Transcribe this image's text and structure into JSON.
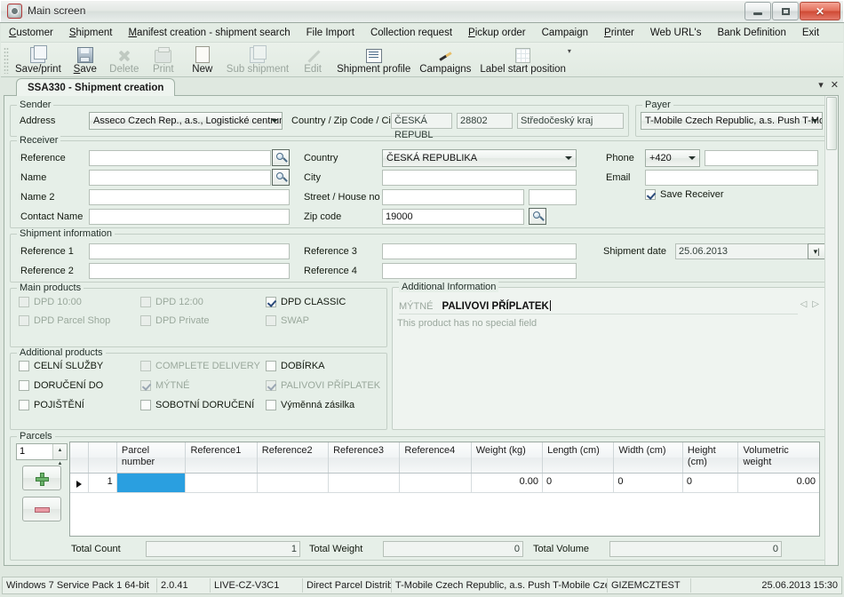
{
  "window": {
    "title": "Main screen",
    "minimize_label": "Minimize",
    "maximize_label": "Maximize",
    "close_label": "✕"
  },
  "menubar": [
    {
      "label": "Customer",
      "accel": "C"
    },
    {
      "label": "Shipment",
      "accel": "S"
    },
    {
      "label": "Manifest creation - shipment search",
      "accel": "M"
    },
    {
      "label": "File Import",
      "accel": ""
    },
    {
      "label": "Collection request",
      "accel": ""
    },
    {
      "label": "Pickup order",
      "accel": "P"
    },
    {
      "label": "Campaign",
      "accel": ""
    },
    {
      "label": "Printer",
      "accel": "P"
    },
    {
      "label": "Web URL's",
      "accel": ""
    },
    {
      "label": "Bank Definition",
      "accel": ""
    },
    {
      "label": "Exit",
      "accel": ""
    }
  ],
  "toolbar": [
    {
      "label": "Save/print",
      "icon": "save-print-icon",
      "enabled": true
    },
    {
      "label": "Save",
      "icon": "floppy-icon",
      "enabled": true
    },
    {
      "label": "Delete",
      "icon": "delete-x-icon",
      "enabled": false
    },
    {
      "label": "Print",
      "icon": "printer-icon",
      "enabled": false
    },
    {
      "label": "New",
      "icon": "new-document-icon",
      "enabled": true
    },
    {
      "label": "Sub shipment",
      "icon": "sub-shipment-icon",
      "enabled": false
    },
    {
      "label": "Edit",
      "icon": "pencil-icon",
      "enabled": false
    },
    {
      "label": "Shipment profile",
      "icon": "shipment-profile-icon",
      "enabled": true
    },
    {
      "label": "Campaigns",
      "icon": "campaign-pen-icon",
      "enabled": true
    },
    {
      "label": "Label start position",
      "icon": "label-grid-icon",
      "enabled": true,
      "dropdown": true
    }
  ],
  "tab": {
    "label": "SSA330 - Shipment creation",
    "minimize_glyph": "▾",
    "close_glyph": "✕"
  },
  "sender": {
    "legend": "Sender",
    "address_label": "Address",
    "address_value": "Asseco Czech Rep., a.s., Logistické centrum",
    "country_zip_city_label": "Country / Zip Code / City",
    "country_value": "ČESKÁ REPUBL",
    "zip_value": "28802",
    "city_value": "Středočeský kraj"
  },
  "payer": {
    "legend": "Payer",
    "value": "T-Mobile Czech Republic, a.s. Push T-Mobile C"
  },
  "receiver": {
    "legend": "Receiver",
    "reference_label": "Reference",
    "reference_value": "",
    "name_label": "Name",
    "name_value": "",
    "name2_label": "Name 2",
    "name2_value": "",
    "contact_name_label": "Contact Name",
    "contact_name_value": "",
    "country_label": "Country",
    "country_value": "ČESKÁ REPUBLIKA",
    "city_label": "City",
    "city_value": "",
    "street_label": "Street / House no",
    "street_value": "",
    "house_no_value": "",
    "zip_label": "Zip code",
    "zip_value": "19000",
    "phone_label": "Phone",
    "phone_prefix": "+420",
    "phone_value": "",
    "email_label": "Email",
    "email_value": "",
    "save_receiver_label": "Save Receiver",
    "save_receiver_checked": true
  },
  "shipment_information": {
    "legend": "Shipment information",
    "reference1_label": "Reference 1",
    "reference1_value": "",
    "reference2_label": "Reference 2",
    "reference2_value": "",
    "reference3_label": "Reference 3",
    "reference3_value": "",
    "reference4_label": "Reference 4",
    "reference4_value": "",
    "shipment_date_label": "Shipment date",
    "shipment_date_value": "25.06.2013"
  },
  "main_products": {
    "legend": "Main products",
    "items": [
      {
        "label": "DPD 10:00",
        "checked": false,
        "enabled": false
      },
      {
        "label": "DPD 12:00",
        "checked": false,
        "enabled": false
      },
      {
        "label": "DPD CLASSIC",
        "checked": true,
        "enabled": true
      },
      {
        "label": "DPD Parcel Shop",
        "checked": false,
        "enabled": false
      },
      {
        "label": "DPD Private",
        "checked": false,
        "enabled": false
      },
      {
        "label": "SWAP",
        "checked": false,
        "enabled": false
      }
    ]
  },
  "additional_products": {
    "legend": "Additional products",
    "items": [
      {
        "label": "CELNÍ SLUŽBY",
        "checked": false,
        "enabled": true
      },
      {
        "label": "COMPLETE DELIVERY",
        "checked": false,
        "enabled": false
      },
      {
        "label": "DOBÍRKA",
        "checked": false,
        "enabled": true
      },
      {
        "label": "DORUČENÍ DO",
        "checked": false,
        "enabled": true
      },
      {
        "label": "MÝTNÉ",
        "checked": true,
        "enabled": false
      },
      {
        "label": "PALIVOVI PŘÍPLATEK",
        "checked": true,
        "enabled": false
      },
      {
        "label": "POJIŠTĚNÍ",
        "checked": false,
        "enabled": true
      },
      {
        "label": "SOBOTNÍ DORUČENÍ",
        "checked": false,
        "enabled": true
      },
      {
        "label": "Výměnná zásilka",
        "checked": false,
        "enabled": true
      }
    ]
  },
  "additional_information": {
    "legend": "Additional Information",
    "tabs": [
      {
        "label": "MÝTNÉ",
        "active": false
      },
      {
        "label": "PALIVOVI PŘÍPLATEK",
        "active": true
      }
    ],
    "nav_prev": "◁",
    "nav_next": "▷",
    "note": "This product has no special field"
  },
  "parcels": {
    "legend": "Parcels",
    "count_value": "1",
    "add_button_label": "add-parcel",
    "remove_button_label": "remove-parcel",
    "columns": [
      "",
      "",
      "Parcel\nnumber",
      "Reference1",
      "Reference2",
      "Reference3",
      "Reference4",
      "Weight (kg)",
      "Length (cm)",
      "Width (cm)",
      "Height\n(cm)",
      "Volumetric\nweight"
    ],
    "column_display": [
      {
        "line1": "",
        "line2": ""
      },
      {
        "line1": "",
        "line2": ""
      },
      {
        "line1": "Parcel",
        "line2": "number"
      },
      {
        "line1": "Reference1",
        "line2": ""
      },
      {
        "line1": "Reference2",
        "line2": ""
      },
      {
        "line1": "Reference3",
        "line2": ""
      },
      {
        "line1": "Reference4",
        "line2": ""
      },
      {
        "line1": "Weight (kg)",
        "line2": ""
      },
      {
        "line1": "Length (cm)",
        "line2": ""
      },
      {
        "line1": "Width (cm)",
        "line2": ""
      },
      {
        "line1": "Height",
        "line2": "(cm)"
      },
      {
        "line1": "Volumetric",
        "line2": "weight"
      }
    ],
    "rows": [
      {
        "marker": "▶",
        "index": "1",
        "parcel_number": "",
        "reference1": "",
        "reference2": "",
        "reference3": "",
        "reference4": "",
        "weight": "0.00",
        "length": "0",
        "width": "0",
        "height": "0",
        "volumetric_weight": "0.00"
      }
    ]
  },
  "totals": {
    "count_label": "Total Count",
    "count_value": "1",
    "weight_label": "Total Weight",
    "weight_value": "0",
    "volume_label": "Total Volume",
    "volume_value": "0"
  },
  "statusbar": {
    "os": "Windows 7 Service Pack 1 64-bit",
    "version": "2.0.41",
    "environment": "LIVE-CZ-V3C1",
    "carrier": "Direct Parcel Distribution",
    "customer": "T-Mobile Czech Republic, a.s. Push T-Mobile Czech R",
    "user": "GIZEMCZTEST",
    "datetime": "25.06.2013 15:30"
  },
  "colors": {
    "form_background": "#e6efe8",
    "selection_blue": "#2a9fe0",
    "close_button_red": "#cf4a33",
    "disabled_text": "#9aa89c"
  }
}
